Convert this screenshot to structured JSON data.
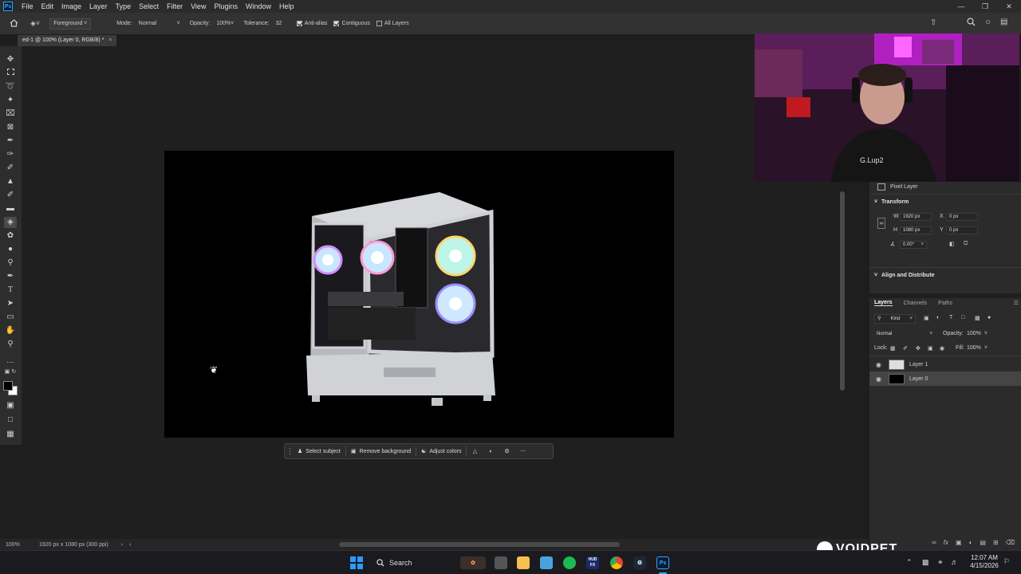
{
  "menubar": {
    "logo": "Ps",
    "items": [
      "File",
      "Edit",
      "Image",
      "Layer",
      "Type",
      "Select",
      "Filter",
      "View",
      "Plugins",
      "Window",
      "Help"
    ]
  },
  "optionsbar": {
    "fill_source": "Foreground",
    "mode_label": "Mode:",
    "mode_value": "Normal",
    "opacity_label": "Opacity:",
    "opacity_value": "100%",
    "tolerance_label": "Tolerance:",
    "tolerance_value": "32",
    "antialias_label": "Anti-alias",
    "contiguous_label": "Contiguous",
    "alllayers_label": "All Layers"
  },
  "document": {
    "tab_title": "ed-1 @ 100% (Layer 0, RGB/8) *"
  },
  "contextbar": {
    "select_subject": "Select subject",
    "remove_background": "Remove background",
    "adjust_colors": "Adjust colors"
  },
  "statusbar": {
    "zoom": "100%",
    "doc_info": "1920 px x 1080 px (300 ppi)"
  },
  "properties": {
    "pixel_layer": "Pixel Layer",
    "transform_title": "Transform",
    "w_label": "W",
    "w_value": "1920 px",
    "h_label": "H",
    "h_value": "1080 px",
    "x_label": "X",
    "x_value": "0 px",
    "y_label": "Y",
    "y_value": "0 px",
    "angle_value": "0.00°",
    "align_title": "Align and Distribute"
  },
  "layers_panel": {
    "tabs": [
      "Layers",
      "Channels",
      "Paths"
    ],
    "kind_label": "Kind",
    "blend_mode": "Normal",
    "opacity_label": "Opacity:",
    "opacity_value": "100%",
    "lock_label": "Lock:",
    "fill_label": "Fill:",
    "fill_value": "100%",
    "layers": [
      {
        "name": "Layer 1",
        "selected": false
      },
      {
        "name": "Layer 0",
        "selected": true
      }
    ]
  },
  "webcam": {
    "shirt_text": "G.Lup2"
  },
  "watermark": "VOIDPET",
  "taskbar": {
    "search_label": "Search",
    "time": "12:07 AM",
    "date": "4/15/2026",
    "hud_label": "HUD",
    "hud_fx": "FX",
    "ps_label": "Ps"
  },
  "colors": {
    "accent": "#31a8ff",
    "canvas_bg": "#000000"
  }
}
